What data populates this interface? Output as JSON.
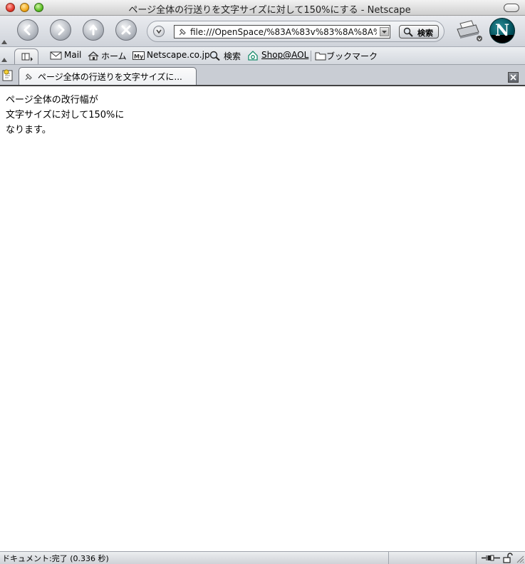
{
  "window": {
    "title": "ページ全体の行送りを文字サイズに対して150%にする - Netscape"
  },
  "navbar": {
    "url": "file:///OpenSpace/%83A%83v%83%8A%8A%D6",
    "search_label": "検索"
  },
  "personal_toolbar": {
    "items": [
      {
        "label": "Mail",
        "icon": "mail-icon"
      },
      {
        "label": "ホーム",
        "icon": "home-icon"
      },
      {
        "label": "Netscape.co.jp",
        "icon": "my-netscape-icon"
      },
      {
        "label": "検索",
        "icon": "search-icon"
      },
      {
        "label": "Shop@AOL",
        "icon": "aol-icon"
      },
      {
        "label": "ブックマーク",
        "icon": "folder-icon"
      }
    ]
  },
  "tabs": [
    {
      "label": "ページ全体の行送りを文字サイズに...",
      "active": true
    }
  ],
  "content": {
    "lines": [
      "ページ全体の改行幅が",
      "文字サイズに対して150%に",
      "なります。"
    ]
  },
  "status": {
    "text": "ドキュメント:完了 (0.336 秒)"
  }
}
